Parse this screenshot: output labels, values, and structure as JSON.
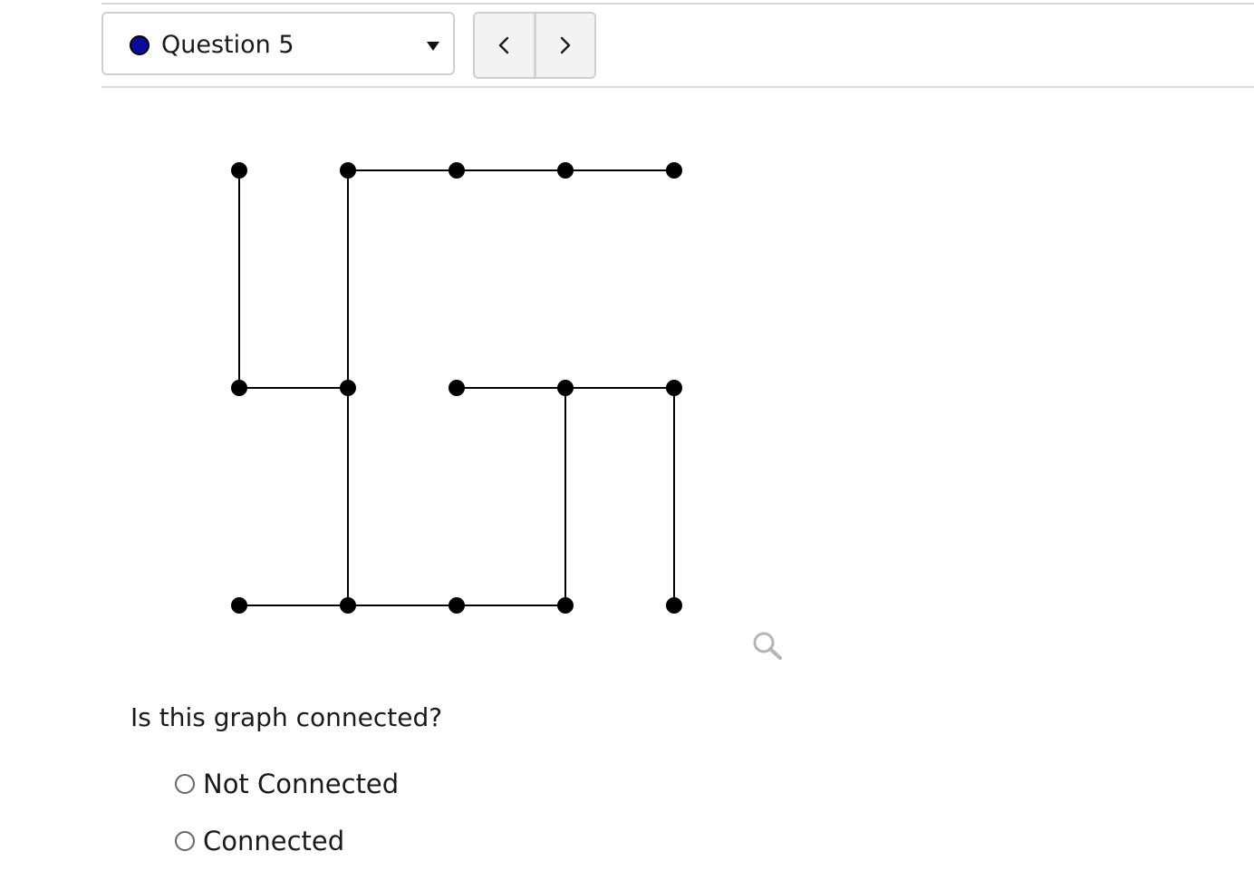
{
  "question_selector": {
    "label": "Question 5",
    "status_color": "#0a0a9e"
  },
  "nav": {
    "prev_icon": "chevron-left-icon",
    "next_icon": "chevron-right-icon"
  },
  "graph": {
    "vertices": [
      {
        "id": "r0c0",
        "row": 0,
        "col": 0
      },
      {
        "id": "r0c1",
        "row": 0,
        "col": 1
      },
      {
        "id": "r0c2",
        "row": 0,
        "col": 2
      },
      {
        "id": "r0c3",
        "row": 0,
        "col": 3
      },
      {
        "id": "r0c4",
        "row": 0,
        "col": 4
      },
      {
        "id": "r1c0",
        "row": 1,
        "col": 0
      },
      {
        "id": "r1c1",
        "row": 1,
        "col": 1
      },
      {
        "id": "r1c2",
        "row": 1,
        "col": 2
      },
      {
        "id": "r1c3",
        "row": 1,
        "col": 3
      },
      {
        "id": "r1c4",
        "row": 1,
        "col": 4
      },
      {
        "id": "r2c0",
        "row": 2,
        "col": 0
      },
      {
        "id": "r2c1",
        "row": 2,
        "col": 1
      },
      {
        "id": "r2c2",
        "row": 2,
        "col": 2
      },
      {
        "id": "r2c3",
        "row": 2,
        "col": 3
      },
      {
        "id": "r2c4",
        "row": 2,
        "col": 4
      }
    ],
    "edges": [
      [
        "r0c0",
        "r1c0"
      ],
      [
        "r1c0",
        "r1c1"
      ],
      [
        "r0c1",
        "r1c1"
      ],
      [
        "r1c1",
        "r2c1"
      ],
      [
        "r0c1",
        "r0c2"
      ],
      [
        "r0c2",
        "r0c3"
      ],
      [
        "r0c3",
        "r0c4"
      ],
      [
        "r2c0",
        "r2c1"
      ],
      [
        "r2c1",
        "r2c2"
      ],
      [
        "r2c2",
        "r2c3"
      ],
      [
        "r1c2",
        "r1c3"
      ],
      [
        "r1c3",
        "r1c4"
      ],
      [
        "r1c3",
        "r2c3"
      ],
      [
        "r1c4",
        "r2c4"
      ]
    ]
  },
  "zoom_icon": "magnifier-icon",
  "question": {
    "prompt": "Is this graph connected?",
    "options": [
      {
        "label": "Not Connected",
        "selected": false
      },
      {
        "label": "Connected",
        "selected": false
      }
    ]
  }
}
